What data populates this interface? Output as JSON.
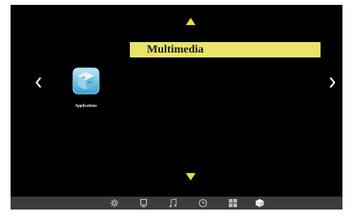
{
  "menu": {
    "title": "Multimedia",
    "title_bg": "#e8e36a",
    "accent": "#f0dc3c",
    "nav_arrows": [
      "up-arrow-icon",
      "down-arrow-icon",
      "left-arrow-icon",
      "right-arrow-icon"
    ]
  },
  "apps": [
    {
      "label": "Applications",
      "icon": "applications-cube-icon",
      "selected": true
    }
  ],
  "bottom_bar": {
    "icons": [
      "settings-icon",
      "display-icon",
      "music-icon",
      "clock-icon",
      "grid-icon",
      "applications-cube-icon"
    ],
    "active": "applications-cube-icon"
  }
}
